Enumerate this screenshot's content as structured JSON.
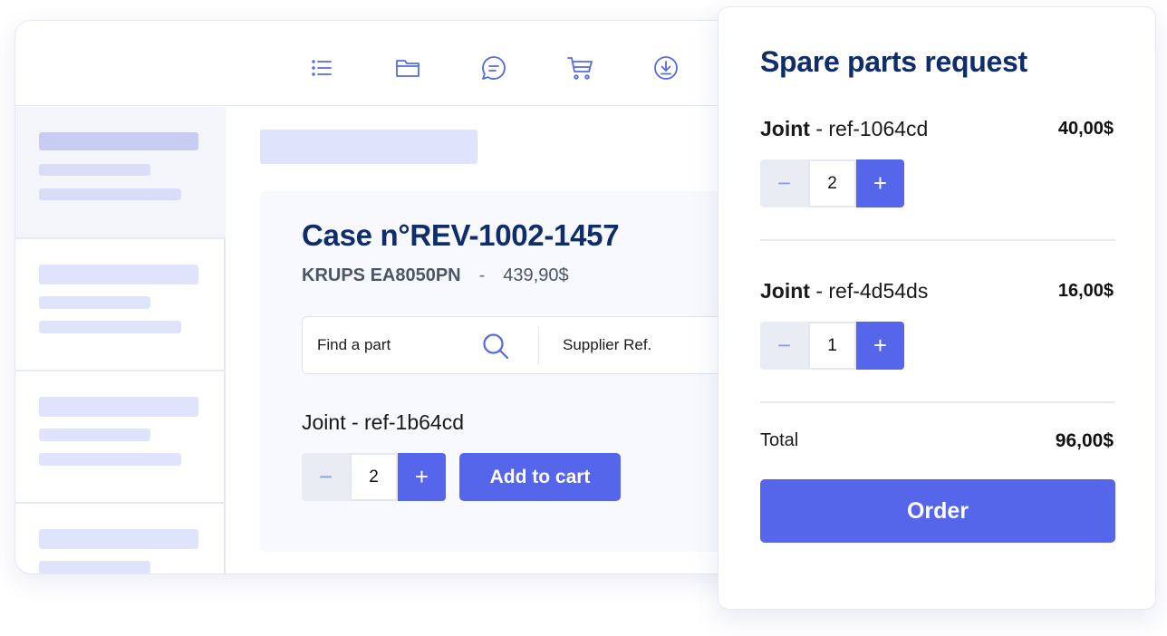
{
  "toolbar": {
    "icons": [
      "list-icon",
      "folder-icon",
      "chat-icon",
      "cart-icon",
      "download-icon"
    ]
  },
  "case": {
    "title": "Case n°REV-1002-1457",
    "model": "KRUPS EA8050PN",
    "separator": "-",
    "price": "439,90$"
  },
  "search": {
    "find_label": "Find a part",
    "supplier_label": "Supplier Ref."
  },
  "part": {
    "name": "Joint - ref-1b64cd",
    "quantity": "2",
    "add_label": "Add to cart"
  },
  "stepper": {
    "minus": "−",
    "plus": "+"
  },
  "panel": {
    "title": "Spare parts request",
    "items": [
      {
        "name": "Joint",
        "ref": " - ref-1064cd",
        "quantity": "2",
        "price": "40,00$"
      },
      {
        "name": "Joint",
        "ref": " - ref-4d54ds",
        "quantity": "1",
        "price": "16,00$"
      }
    ],
    "total_label": "Total",
    "total_value": "96,00$",
    "order_label": "Order"
  },
  "colors": {
    "accent": "#5566ea",
    "title": "#0f2d6b",
    "placeholder": "#dfe3fb"
  }
}
